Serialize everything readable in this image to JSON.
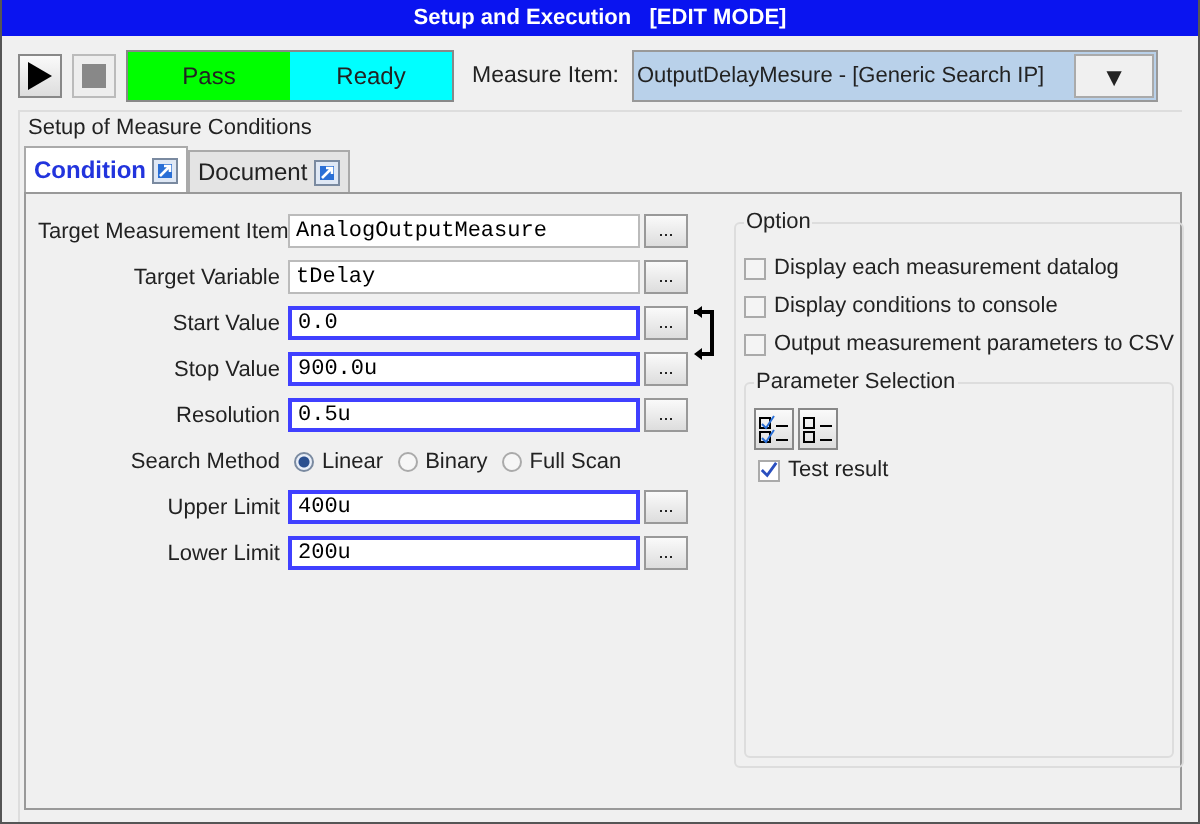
{
  "window": {
    "title": "Setup and Execution   [EDIT MODE]"
  },
  "toolbar": {
    "status": [
      {
        "label": "Pass",
        "color": "#00ff00"
      },
      {
        "label": "Ready",
        "color": "#00ffff"
      }
    ],
    "measure_item_label": "Measure Item:",
    "measure_item_value": "OutputDelayMesure - [Generic Search IP]",
    "dropdown_arrow": "▼"
  },
  "section_title": "Setup of Measure Conditions",
  "tabs": [
    {
      "label": "Condition",
      "selected": true
    },
    {
      "label": "Document",
      "selected": false
    }
  ],
  "fields": [
    {
      "kind": "text",
      "label": "Target Measurement Item",
      "value": "AnalogOutputMeasure",
      "highlighted": false,
      "button": "..."
    },
    {
      "kind": "text",
      "label": "Target Variable",
      "value": "tDelay",
      "highlighted": false,
      "button": "..."
    },
    {
      "kind": "text",
      "label": "Start Value",
      "value": "0.0",
      "highlighted": true,
      "button": "..."
    },
    {
      "kind": "text",
      "label": "Stop Value",
      "value": "900.0u",
      "highlighted": true,
      "button": "..."
    },
    {
      "kind": "text",
      "label": "Resolution",
      "value": "0.5u",
      "highlighted": true,
      "button": "..."
    },
    {
      "kind": "radio",
      "label": "Search Method",
      "options": [
        {
          "label": "Linear",
          "selected": true
        },
        {
          "label": "Binary",
          "selected": false
        },
        {
          "label": "Full Scan",
          "selected": false
        }
      ]
    },
    {
      "kind": "text",
      "label": "Upper Limit",
      "value": "400u",
      "highlighted": true,
      "button": "..."
    },
    {
      "kind": "text",
      "label": "Lower Limit",
      "value": "200u",
      "highlighted": true,
      "button": "..."
    }
  ],
  "option": {
    "title": "Option",
    "checkboxes": [
      {
        "label": "Display each measurement datalog",
        "checked": false
      },
      {
        "label": "Display conditions to console",
        "checked": false
      },
      {
        "label": "Output measurement parameters to CSV",
        "checked": false
      }
    ],
    "parameter_selection": {
      "title": "Parameter Selection",
      "items": [
        {
          "label": "Test result",
          "checked": true
        }
      ]
    }
  }
}
